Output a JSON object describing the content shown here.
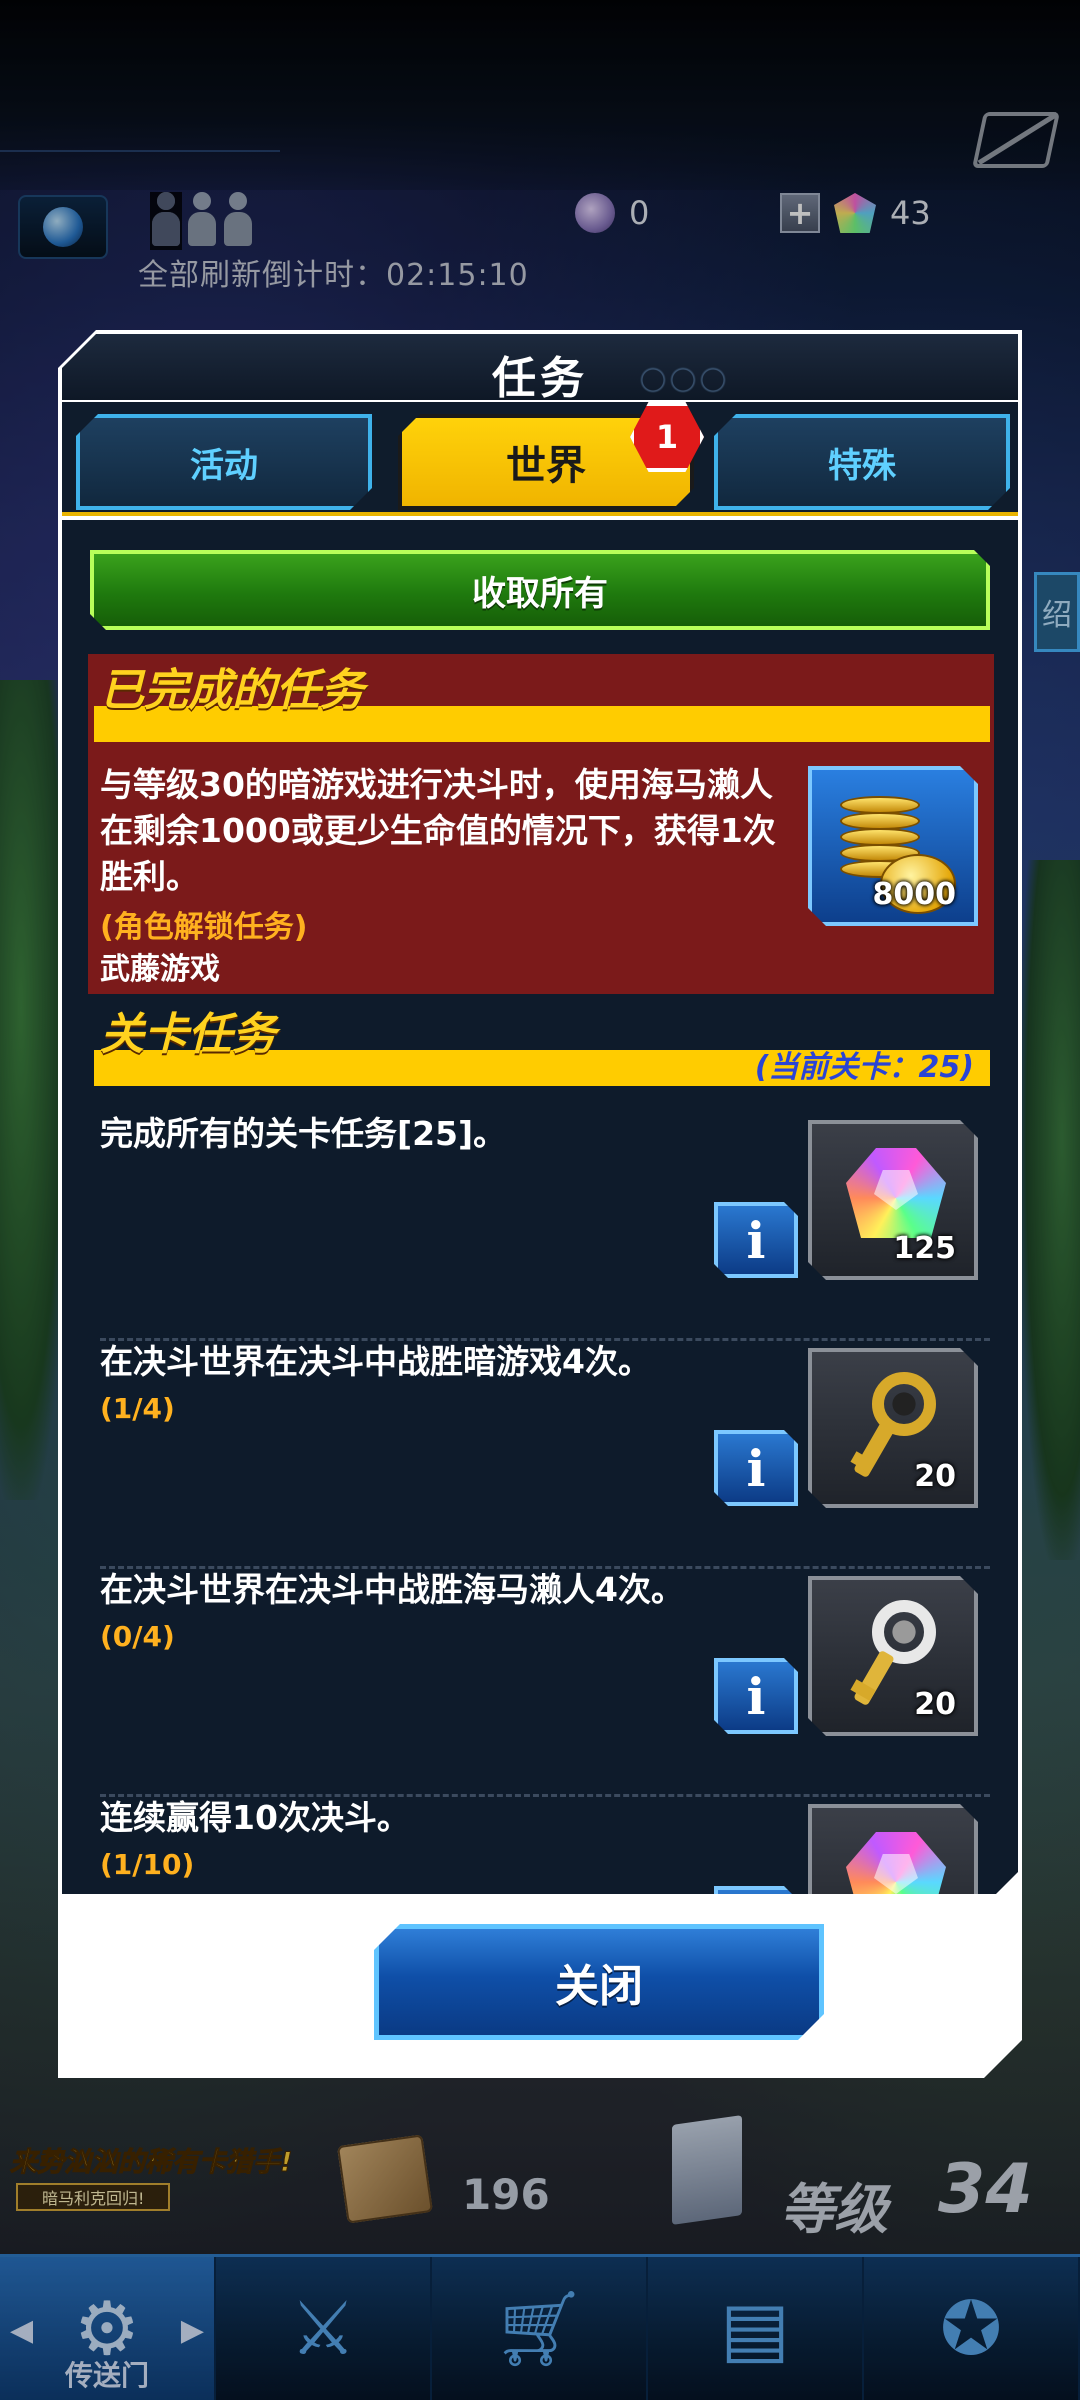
{
  "hud": {
    "refresh_countdown": "全部刷新倒计时：02:15:10",
    "orb_count": "0",
    "gem_count": "43",
    "plus_label": "+",
    "side_sign": "绍"
  },
  "modal": {
    "title": "任务",
    "tabs": [
      {
        "label": "活动",
        "active": false
      },
      {
        "label": "世界",
        "active": true
      },
      {
        "label": "特殊",
        "active": false
      }
    ],
    "tab_badge": "1",
    "claim_all": "收取所有",
    "completed_section": {
      "title": "已完成的任务",
      "task_text": "与等级30的暗游戏进行决斗时，使用海马濑人在剩余1000或更少生命值的情况下，获得1次胜利。",
      "tag": "(角色解锁任务)",
      "character": "武藤游戏",
      "reward": {
        "icon": "gold-coins-icon",
        "qty": "8000"
      }
    },
    "stage_section": {
      "title": "关卡任务",
      "current_stage": "(当前关卡：25)",
      "tasks": [
        {
          "desc": "完成所有的关卡任务[25]。",
          "progress": "",
          "reward_icon": "rainbow-gem-icon",
          "reward_qty": "125"
        },
        {
          "desc": "在决斗世界在决斗中战胜暗游戏4次。",
          "progress": "(1/4)",
          "reward_icon": "gold-key-icon",
          "reward_qty": "20"
        },
        {
          "desc": "在决斗世界在决斗中战胜海马濑人4次。",
          "progress": "(0/4)",
          "reward_icon": "silver-key-icon",
          "reward_qty": "20"
        },
        {
          "desc": "连续赢得10次决斗。",
          "progress": "(1/10)",
          "reward_icon": "rainbow-gem-icon",
          "reward_qty": ""
        }
      ]
    },
    "info_label": "i",
    "close": "关闭"
  },
  "bottom": {
    "event_title": "来势汹汹的稀有卡猎手!",
    "event_subtitle": "暗马利克回归!",
    "map_count": "196",
    "level_label": "等级",
    "level_value": "34",
    "nav": [
      {
        "label": "传送门",
        "icon": "portal-icon"
      },
      {
        "label": "",
        "icon": "duel-swords-icon"
      },
      {
        "label": "",
        "icon": "shop-cart-icon"
      },
      {
        "label": "",
        "icon": "deck-cards-icon"
      },
      {
        "label": "",
        "icon": "character-emblem-icon"
      }
    ]
  },
  "colors": {
    "accent_yellow": "#ffcc00",
    "completed_bg": "#7b1a1a",
    "panel_bg": "#0e1b2b",
    "claim_green": "#2a8e14",
    "button_blue": "#0f4fa8"
  }
}
